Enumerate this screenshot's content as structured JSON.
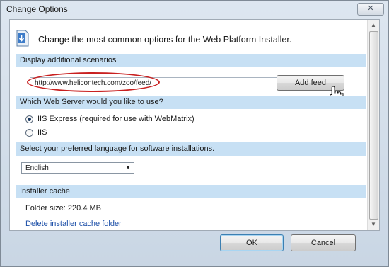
{
  "window": {
    "title": "Change Options",
    "close_label": "✕"
  },
  "header": {
    "text": "Change the most common options for the Web Platform Installer."
  },
  "scenarios": {
    "heading": "Display additional scenarios",
    "feed_url": "http://www.helicontech.com/zoo/feed/",
    "add_feed_label": "Add feed"
  },
  "web_server": {
    "heading": "Which Web Server would you like to use?",
    "options": [
      {
        "label": "IIS Express (required for use with WebMatrix)",
        "checked": true
      },
      {
        "label": "IIS",
        "checked": false
      }
    ]
  },
  "language": {
    "heading": "Select your preferred language for software installations.",
    "selected": "English"
  },
  "cache": {
    "heading": "Installer cache",
    "folder_size": "Folder size: 220.4 MB",
    "delete_link": "Delete installer cache folder"
  },
  "footer": {
    "ok_label": "OK",
    "cancel_label": "Cancel"
  },
  "colors": {
    "section_bg": "#c7e0f4",
    "highlight": "#c82020",
    "link": "#1c4fa8"
  }
}
